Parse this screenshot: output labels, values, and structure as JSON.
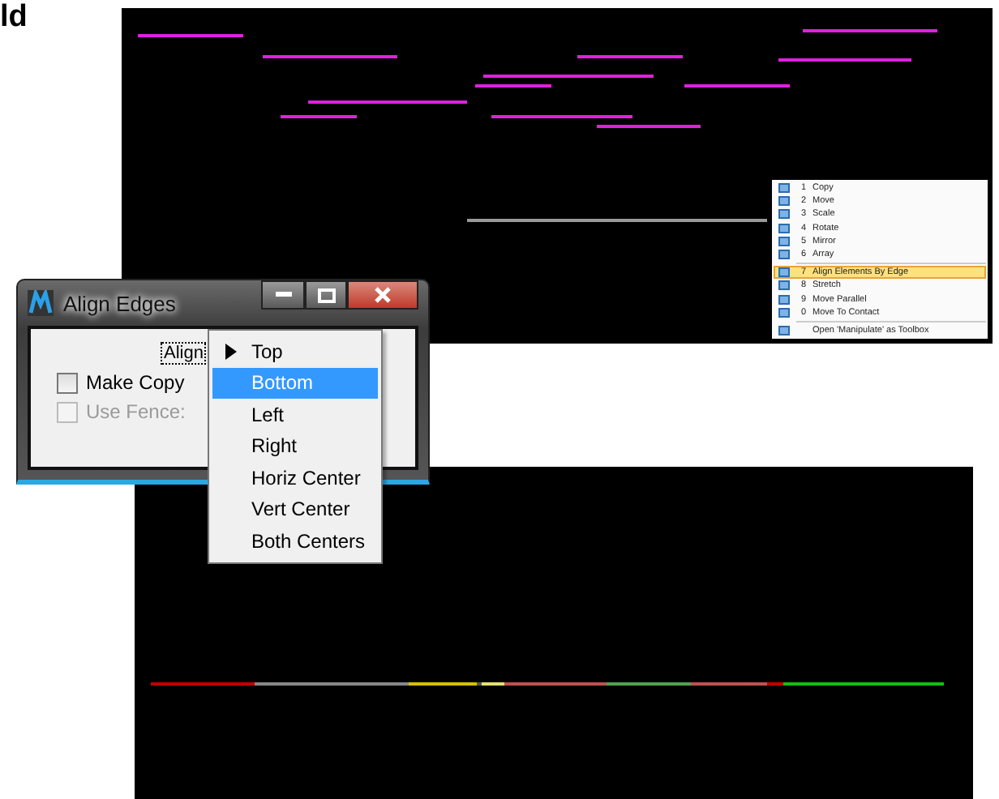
{
  "heading_fragment": "ld",
  "context_menu": {
    "items": [
      {
        "key": "1",
        "label": "Copy",
        "selected": false
      },
      {
        "key": "2",
        "label": "Move",
        "selected": false
      },
      {
        "key": "3",
        "label": "Scale",
        "selected": false
      },
      {
        "key": "4",
        "label": "Rotate",
        "selected": false
      },
      {
        "key": "5",
        "label": "Mirror",
        "selected": false
      },
      {
        "key": "6",
        "label": "Array",
        "selected": false
      },
      {
        "key": "7",
        "label": "Align Elements By Edge",
        "selected": true
      },
      {
        "key": "8",
        "label": "Stretch",
        "selected": false
      },
      {
        "key": "9",
        "label": "Move Parallel",
        "selected": false
      },
      {
        "key": "0",
        "label": "Move To Contact",
        "selected": false
      }
    ],
    "footer": "Open 'Manipulate' as Toolbox"
  },
  "dialog": {
    "title": "Align Edges",
    "align_label": "Align",
    "checkboxes": [
      {
        "label": "Make Copy",
        "checked": false,
        "disabled": false
      },
      {
        "label": "Use Fence:",
        "checked": false,
        "disabled": true
      }
    ]
  },
  "align_dropdown": {
    "options": [
      {
        "label": "Top",
        "current": true,
        "selected": false
      },
      {
        "label": "Bottom",
        "current": false,
        "selected": true
      },
      {
        "label": "Left",
        "current": false,
        "selected": false
      },
      {
        "label": "Right",
        "current": false,
        "selected": false
      },
      {
        "label": "Horiz Center",
        "current": false,
        "selected": false
      },
      {
        "label": "Vert Center",
        "current": false,
        "selected": false
      },
      {
        "label": "Both Centers",
        "current": false,
        "selected": false
      }
    ]
  }
}
